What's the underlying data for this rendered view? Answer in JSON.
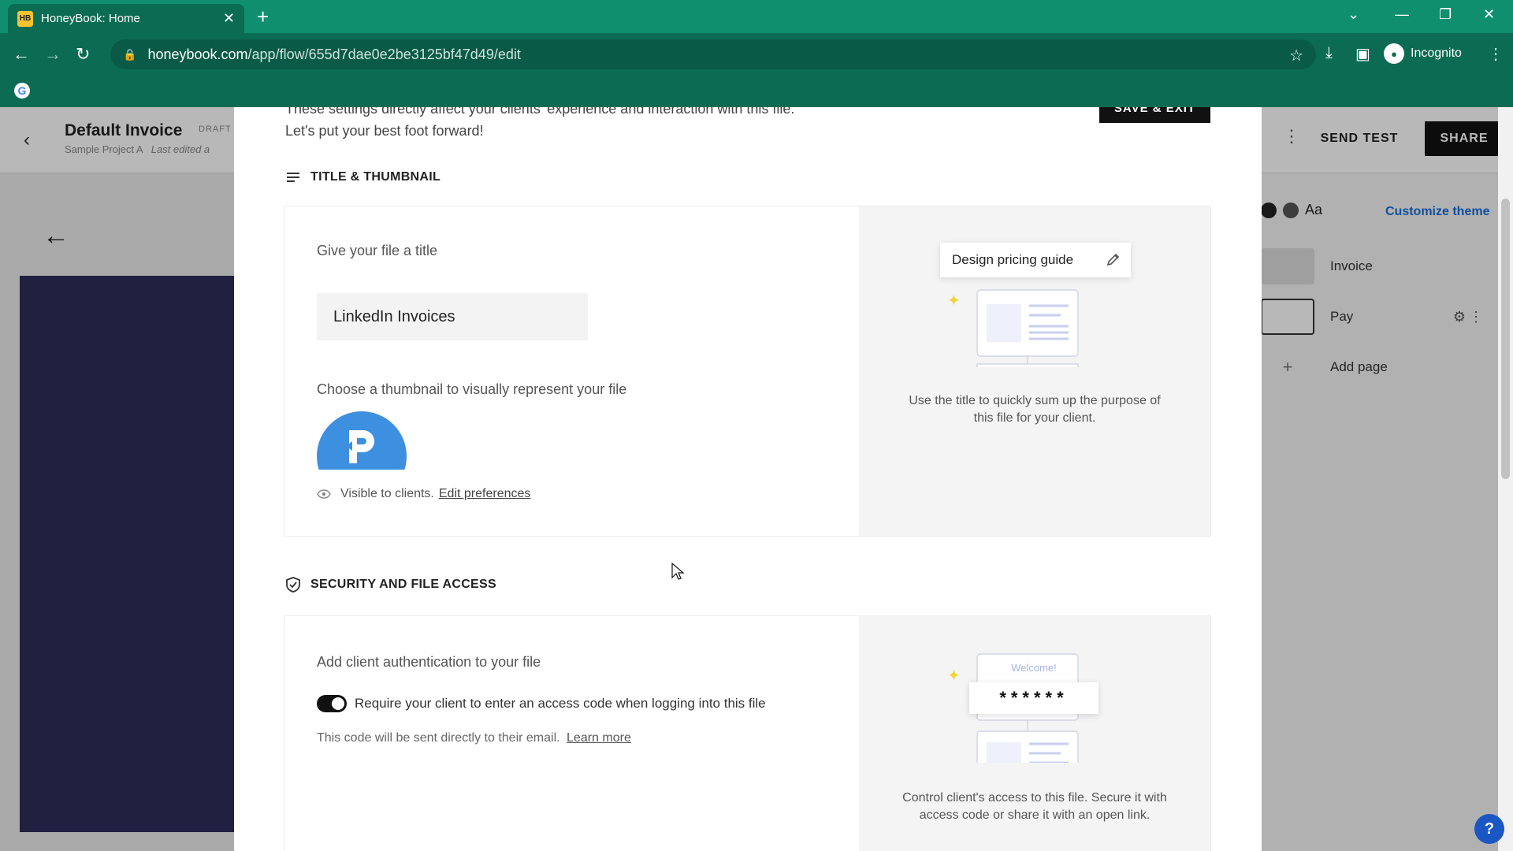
{
  "browser": {
    "tab_title": "HoneyBook: Home",
    "favicon_text": "HB",
    "url_host": "honeybook.com",
    "url_path": "/app/flow/655d7dae0e2be3125bf47d49/edit",
    "profile_label": "Incognito",
    "theme_color": "#0f8f6d"
  },
  "app": {
    "doc_title": "Default Invoice",
    "doc_badge": "DRAFT",
    "doc_project": "Sample Project A",
    "doc_edited": "Last edited a",
    "send_test": "SEND TEST",
    "share": "SHARE",
    "theme_font": "Aa",
    "customize_theme": "Customize theme",
    "pages": [
      {
        "label": "Invoice"
      },
      {
        "label": "Pay"
      }
    ],
    "add_page": "Add page",
    "preview_color": "#2f2d5a"
  },
  "modal": {
    "intro_line1": "These settings directly affect your clients' experience and interaction with this file.",
    "intro_line2": "Let's put your best foot forward!",
    "save_exit": "SAVE & EXIT",
    "title_section": {
      "heading": "TITLE & THUMBNAIL",
      "title_label": "Give your file a title",
      "title_value": "LinkedIn Invoices",
      "thumbnail_label": "Choose a thumbnail to visually represent your file",
      "visible_text": "Visible to clients.",
      "edit_preferences": "Edit preferences",
      "illus_tag": "Design pricing guide",
      "illus_caption": "Use the title to quickly sum up the purpose of this file for your client."
    },
    "security_section": {
      "heading": "SECURITY AND FILE ACCESS",
      "auth_label": "Add client authentication to your file",
      "toggle_label": "Require your client to enter an access code when logging into this file",
      "toggle_on": true,
      "code_note": "This code will be sent directly to their email.",
      "learn_more": "Learn more",
      "illus_welcome": "Welcome!",
      "illus_stars": "******",
      "illus_caption": "Control client's access to this file. Secure it with access code or share it with an open link."
    }
  }
}
